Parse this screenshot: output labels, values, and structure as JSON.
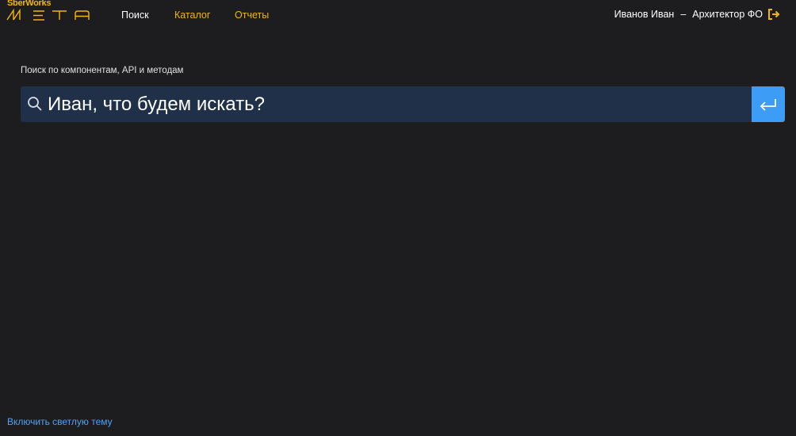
{
  "logo": {
    "small_text": "SberWorks",
    "big_text": "МЕТА"
  },
  "nav": {
    "items": [
      {
        "label": "Поиск",
        "active": true
      },
      {
        "label": "Каталог",
        "active": false
      },
      {
        "label": "Отчеты",
        "active": false
      }
    ]
  },
  "user": {
    "name": "Иванов Иван",
    "separator": "–",
    "role": "Архитектор ФО",
    "logout_icon": "logout-icon"
  },
  "search": {
    "label": "Поиск по компонентам, API и методам",
    "placeholder": "Иван, что будем искать?",
    "value": "",
    "submit_icon": "enter-icon"
  },
  "footer": {
    "theme_toggle": "Включить светлую тему"
  },
  "colors": {
    "background": "#1d1d1f",
    "accent": "#f2b705",
    "search_bg": "#1f3048",
    "button": "#3d9cf5",
    "link": "#4da3f5"
  }
}
